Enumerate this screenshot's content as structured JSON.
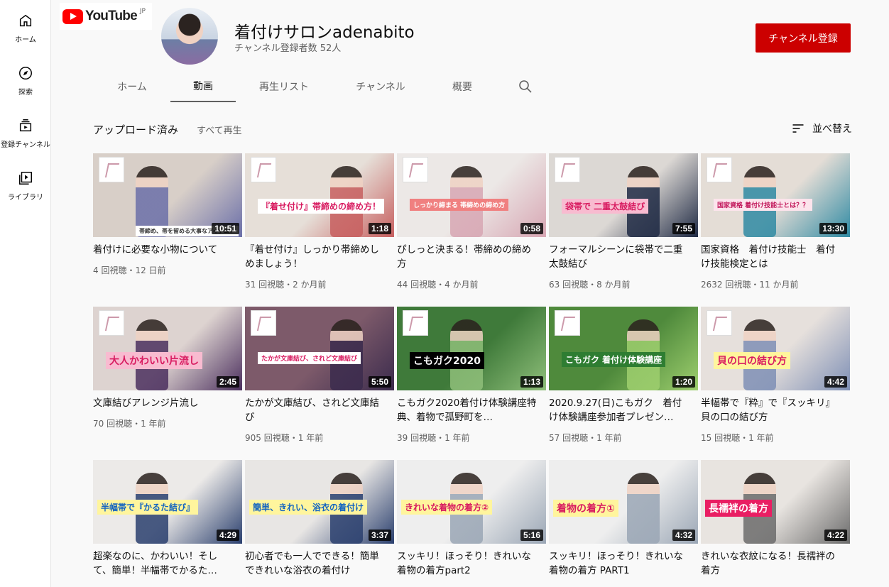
{
  "guide": {
    "items": [
      {
        "label": "ホーム",
        "icon": "home-icon"
      },
      {
        "label": "探索",
        "icon": "compass-icon"
      },
      {
        "label": "登録チャンネル",
        "icon": "subscriptions-icon"
      },
      {
        "label": "ライブラリ",
        "icon": "library-icon"
      }
    ]
  },
  "logo": {
    "text": "YouTube",
    "country": "JP"
  },
  "channel": {
    "name": "着付けサロンadenabito",
    "subscribers": "チャンネル登録者数 52人",
    "subscribe_label": "チャンネル登録"
  },
  "tabs": [
    {
      "label": "ホーム",
      "active": false
    },
    {
      "label": "動画",
      "active": true
    },
    {
      "label": "再生リスト",
      "active": false
    },
    {
      "label": "チャンネル",
      "active": false
    },
    {
      "label": "概要",
      "active": false
    }
  ],
  "shelf": {
    "title": "アップロード済み",
    "play_all": "すべて再生",
    "sort_label": "並べ替え"
  },
  "videos": [
    {
      "title": "着付けに必要な小物について",
      "views": "4 回視聴",
      "age": "12 日前",
      "duration": "10:51",
      "thumb_bg": "#d8cfc8",
      "accent": "#6b6fa8",
      "overlay": "帯締め、帯を留める大事なアイテム！",
      "overlay_color": "#333333",
      "overlay_bg": "#ffffff"
    },
    {
      "title": "『着せ付け』しっかり帯締めしめましょう！",
      "views": "31 回視聴",
      "age": "2 か月前",
      "duration": "1:18",
      "thumb_bg": "#e6dfd8",
      "accent": "#c75f5f",
      "overlay": "『着せ付け』帯締めの締め方！",
      "overlay_color": "#d81b60",
      "overlay_bg": "#ffffff"
    },
    {
      "title": "ぴしっと決まる！帯締めの締め方",
      "views": "44 回視聴",
      "age": "4 か月前",
      "duration": "0:58",
      "thumb_bg": "#ece8e6",
      "accent": "#d7a6b3",
      "overlay": "しっかり締まる 帯締めの締め方",
      "overlay_color": "#ffffff",
      "overlay_bg": "#f08080"
    },
    {
      "title": "フォーマルシーンに袋帯で二重太鼓結び",
      "views": "63 回視聴",
      "age": "8 か月前",
      "duration": "7:55",
      "thumb_bg": "#dcd8d4",
      "accent": "#1f2a44",
      "overlay": "袋帯で 二重太鼓結び",
      "overlay_color": "#d81b60",
      "overlay_bg": "#f8bbd0"
    },
    {
      "title": "国家資格　着付け技能士　着付け技能検定とは",
      "views": "2632 回視聴",
      "age": "11 か月前",
      "duration": "13:30",
      "thumb_bg": "#e4ddd6",
      "accent": "#2f8aa3",
      "overlay": "国家資格 着付け技能士とは？？",
      "overlay_color": "#c2185b",
      "overlay_bg": "#fce4ec"
    },
    {
      "title": "文庫結びアレンジ片流し",
      "views": "70 回視聴",
      "age": "1 年前",
      "duration": "2:45",
      "thumb_bg": "#ddd3d0",
      "accent": "#4b2f5e",
      "overlay": "大人かわいい片流し",
      "overlay_color": "#d81b60",
      "overlay_bg": "#f8bbd0"
    },
    {
      "title": "たかが文庫結び、されど文庫結び",
      "views": "905 回視聴",
      "age": "1 年前",
      "duration": "5:50",
      "thumb_bg": "#7d5a6a",
      "accent": "#3b2b4d",
      "overlay": "たかが文庫結び、されど文庫結び",
      "overlay_color": "#d81b60",
      "overlay_bg": "#ffffff"
    },
    {
      "title": "こもガク2020着付け体験講座特典、着物で孤野町を…",
      "views": "39 回視聴",
      "age": "1 年前",
      "duration": "1:13",
      "thumb_bg": "#3f7a3a",
      "accent": "#8fbf7a",
      "overlay": "こもガク2020",
      "overlay_color": "#ffffff",
      "overlay_bg": "#000000"
    },
    {
      "title": "2020.9.27(日)こもガク　着付け体験講座参加者プレゼン…",
      "views": "57 回視聴",
      "age": "1 年前",
      "duration": "1:20",
      "thumb_bg": "#4f8a3c",
      "accent": "#9ecf6e",
      "overlay": "こもガク 着付け体験講座",
      "overlay_color": "#ffffff",
      "overlay_bg": "#2e7d32"
    },
    {
      "title": "半幅帯で『粋』で『スッキリ』貝の口の結び方",
      "views": "15 回視聴",
      "age": "1 年前",
      "duration": "4:42",
      "thumb_bg": "#e6e0dc",
      "accent": "#7e8fb5",
      "overlay": "貝の口の結び方",
      "overlay_color": "#d81b60",
      "overlay_bg": "#fff59d"
    },
    {
      "title": "超楽なのに、かわいい！そして、簡単！半幅帯でかるた…",
      "views": "",
      "age": "",
      "duration": "4:29",
      "thumb_bg": "#eceae8",
      "accent": "#2a3f6e",
      "overlay": "半幅帯で『かるた結び』",
      "overlay_color": "#1565c0",
      "overlay_bg": "#fff59d"
    },
    {
      "title": "初心者でも一人でできる！簡単できれいな浴衣の着付け",
      "views": "",
      "age": "",
      "duration": "3:37",
      "thumb_bg": "#e8e6e4",
      "accent": "#2a3f6e",
      "overlay": "簡単、きれい、浴衣の着付け",
      "overlay_color": "#1565c0",
      "overlay_bg": "#fff59d"
    },
    {
      "title": "スッキリ！ほっそり！きれいな着物の着方part2",
      "views": "",
      "age": "",
      "duration": "5:16",
      "thumb_bg": "#eeeeee",
      "accent": "#9aa6b5",
      "overlay": "きれいな着物の着方②",
      "overlay_color": "#d81b60",
      "overlay_bg": "#fff59d"
    },
    {
      "title": "スッキリ！ほっそり！きれいな着物の着方 PART1",
      "views": "",
      "age": "",
      "duration": "4:32",
      "thumb_bg": "#eeeeee",
      "accent": "#9aa6b5",
      "overlay": "着物の着方①",
      "overlay_color": "#d81b60",
      "overlay_bg": "#fff59d"
    },
    {
      "title": "きれいな衣紋になる！長襦袢の着方",
      "views": "",
      "age": "",
      "duration": "4:22",
      "thumb_bg": "#e8e4e0",
      "accent": "#6b6b6b",
      "overlay": "長襦袢の着方",
      "overlay_color": "#ffffff",
      "overlay_bg": "#e91e63"
    }
  ]
}
